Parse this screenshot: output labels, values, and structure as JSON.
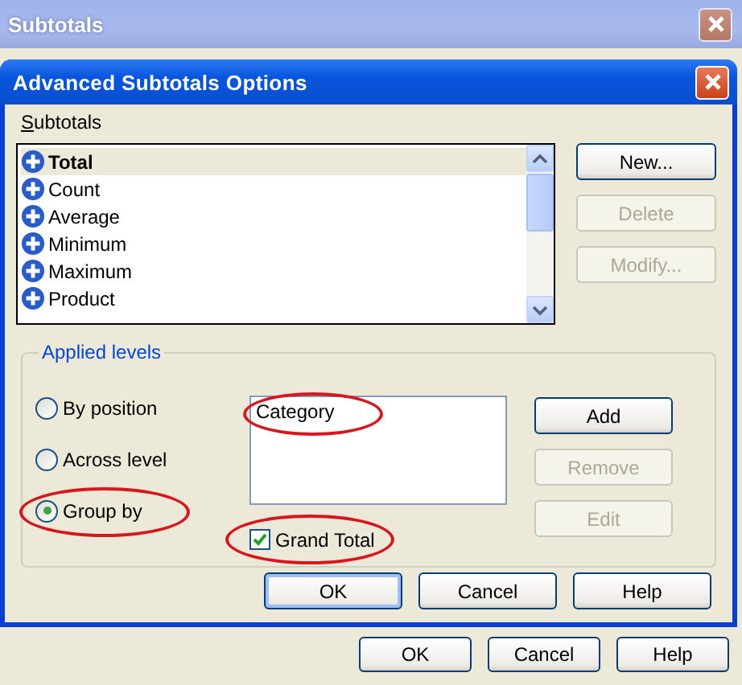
{
  "outer_window": {
    "title": "Subtotals",
    "buttons": [
      {
        "label": "OK"
      },
      {
        "label": "Cancel"
      },
      {
        "label": "Help"
      }
    ]
  },
  "dialog": {
    "title": "Advanced Subtotals Options",
    "subtotals_label": "Subtotals",
    "subtotals": [
      {
        "label": "Total",
        "selected": true
      },
      {
        "label": "Count",
        "selected": false
      },
      {
        "label": "Average",
        "selected": false
      },
      {
        "label": "Minimum",
        "selected": false
      },
      {
        "label": "Maximum",
        "selected": false
      },
      {
        "label": "Product",
        "selected": false
      }
    ],
    "side_buttons": [
      {
        "label": "New...",
        "disabled": false
      },
      {
        "label": "Delete",
        "disabled": true
      },
      {
        "label": "Modify...",
        "disabled": true
      }
    ],
    "applied_levels": {
      "title": "Applied levels",
      "options": [
        {
          "label": "By position",
          "selected": false,
          "circled": false
        },
        {
          "label": "Across level",
          "selected": false,
          "circled": false
        },
        {
          "label": "Group by",
          "selected": true,
          "circled": true
        }
      ],
      "levels": [
        {
          "label": "Category",
          "circled": true
        }
      ],
      "grand_total": {
        "label": "Grand Total",
        "checked": true,
        "circled": true
      },
      "buttons": [
        {
          "label": "Add",
          "disabled": false
        },
        {
          "label": "Remove",
          "disabled": true
        },
        {
          "label": "Edit",
          "disabled": true
        }
      ]
    },
    "buttons": [
      {
        "label": "OK",
        "focused": true
      },
      {
        "label": "Cancel",
        "focused": false
      },
      {
        "label": "Help",
        "focused": false
      }
    ]
  }
}
